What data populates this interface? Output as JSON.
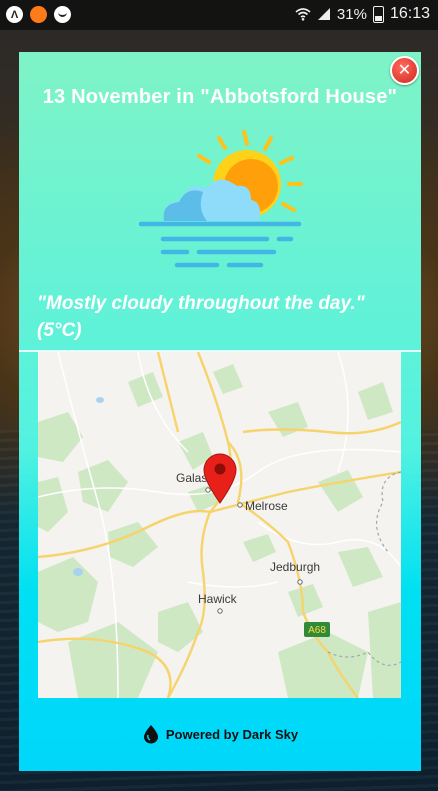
{
  "status_bar": {
    "battery_percent": "31%",
    "time": "16:13",
    "notification_icons": [
      "a-app-icon",
      "orange-dot-icon",
      "smiley-icon"
    ]
  },
  "card": {
    "title": "13 November in \"Abbotsford House\"",
    "summary": "\"Mostly cloudy throughout the day.\" (5°C)",
    "weather_icon": "partly-cloudy-sun-icon",
    "close_icon": "close-icon",
    "close_label": "✕"
  },
  "map": {
    "labels": {
      "galashiels": "Galashiels",
      "melrose": "Melrose",
      "jedburgh": "Jedburgh",
      "hawick": "Hawick",
      "road": "A68"
    },
    "marker": "location-pin-icon"
  },
  "footer": {
    "powered_by": "Powered by Dark Sky",
    "logo_icon": "dark-sky-logo-icon"
  },
  "colors": {
    "card_top": "#7ff3c7",
    "card_bottom": "#00d7fb",
    "close_red": "#e8362a",
    "pin_red": "#e8201a",
    "sun": "#ffb703",
    "cloud": "#6dcaf2"
  }
}
